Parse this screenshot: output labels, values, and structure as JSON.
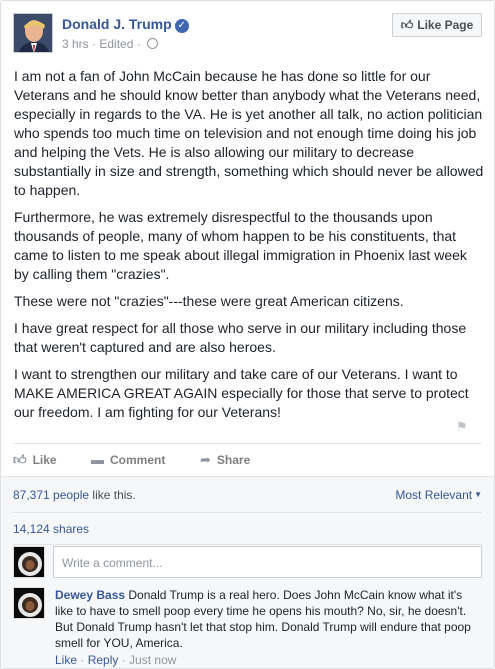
{
  "header": {
    "page_name": "Donald J. Trump",
    "timestamp": "3 hrs",
    "edited": "Edited",
    "like_page_button": "Like Page"
  },
  "post": {
    "paragraphs": [
      "I am not a fan of John McCain because he has done so little for our Veterans and he should know better than anybody what the Veterans need, especially in regards to the VA. He is yet another all talk, no action politician who spends too much time on television and not enough time doing his job and helping the Vets. He is also allowing our military to decrease substantially in size and strength, something which should never be allowed to happen.",
      "Furthermore, he was extremely disrespectful to the thousands upon thousands of people, many of whom happen to be his constituents, that came to listen to me speak about illegal immigration in Phoenix last week by calling them \"crazies\".",
      "These were not \"crazies\"---these were great American citizens.",
      "I have great respect for all those who serve in our military including those that weren't captured and are also heroes.",
      "I want to strengthen our military and take care of our Veterans. I want to MAKE AMERICA GREAT AGAIN especially for those that serve to protect our freedom. I am fighting for our Veterans!"
    ]
  },
  "actions": {
    "like": "Like",
    "comment": "Comment",
    "share": "Share"
  },
  "stats": {
    "likes_count": "87,371 people",
    "likes_suffix": " like this.",
    "sort_label": "Most Relevant",
    "shares": "14,124 shares"
  },
  "composer": {
    "placeholder": "Write a comment..."
  },
  "comment": {
    "author": "Dewey Bass",
    "text": "Donald Trump is a real hero. Does John McCain know what it's like to have to smell poop every time he opens his mouth? No, sir, he doesn't. But Donald Trump hasn't let that stop him. Donald Trump will endure that poop smell for YOU, America.",
    "like": "Like",
    "reply": "Reply",
    "time": "Just now"
  },
  "colors": {
    "link": "#365899",
    "muted": "#90949c",
    "verified": "#4267b2"
  }
}
